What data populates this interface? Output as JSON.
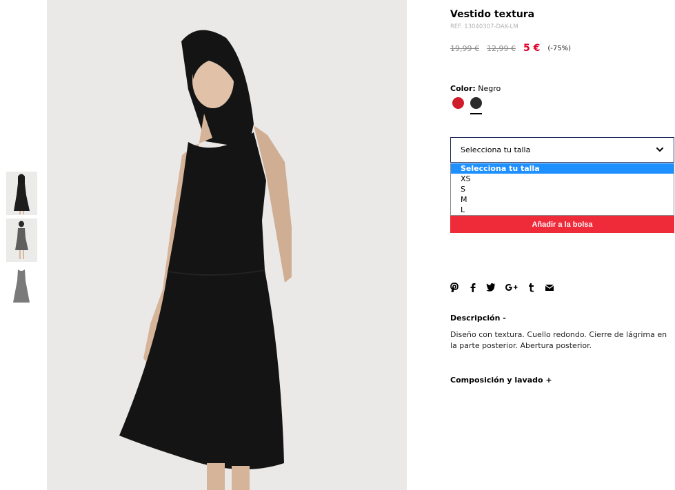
{
  "product": {
    "title": "Vestido textura",
    "ref": "REF. 13040307-DAK-LM",
    "price_original_1": "19,99 €",
    "price_original_2": "12,99 €",
    "price_sale": "5 €",
    "discount": "(-75%)"
  },
  "color": {
    "label": "Color:",
    "selected": "Negro",
    "swatches": [
      {
        "name": "Rojo",
        "hex": "#cf1d2b"
      },
      {
        "name": "Negro",
        "hex": "#2b2b2b",
        "selected": true
      }
    ]
  },
  "size": {
    "select_value": "Selecciona tu talla",
    "options": [
      "Selecciona tu talla",
      "XS",
      "S",
      "M",
      "L"
    ],
    "highlighted_index": 0
  },
  "cart": {
    "add_label": "Añadir a la bolsa"
  },
  "share": {
    "icons": [
      "pinterest-icon",
      "facebook-icon",
      "twitter-icon",
      "google-plus-icon",
      "tumblr-icon",
      "email-icon"
    ],
    "labels": [
      "P",
      "f",
      "t",
      "G+",
      "t",
      "✉"
    ]
  },
  "description": {
    "heading": "Descripción -",
    "text": "Diseño con textura. Cuello redondo. Cierre de lágrima en la parte posterior. Abertura posterior."
  },
  "composition": {
    "heading": "Composición y lavado +"
  },
  "colors": {
    "sale_red": "#e0002a",
    "button_red": "#ef2b3a",
    "option_highlight": "#1e90ff",
    "select_border": "#1f2b5a"
  }
}
